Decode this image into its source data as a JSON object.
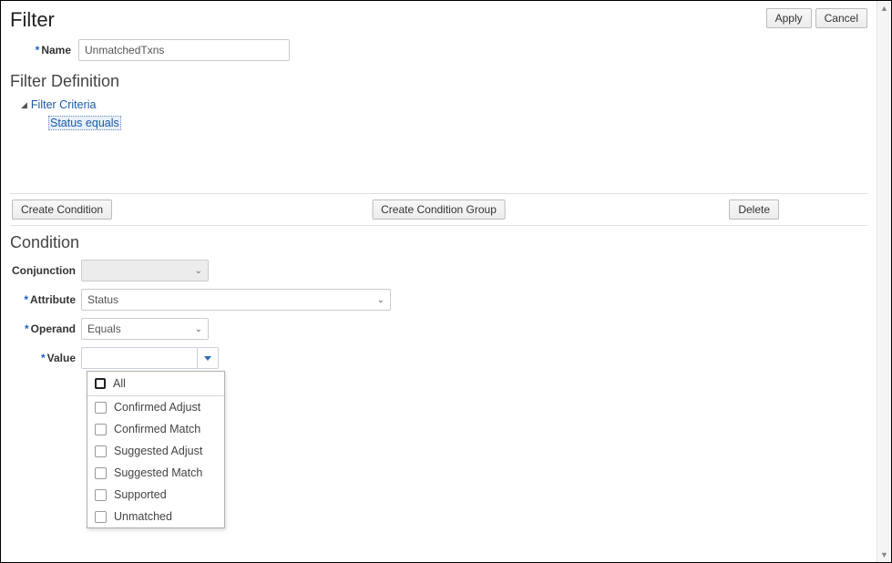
{
  "header": {
    "title": "Filter",
    "apply_label": "Apply",
    "cancel_label": "Cancel"
  },
  "name_field": {
    "label": "Name",
    "value": "UnmatchedTxns"
  },
  "definition": {
    "title": "Filter Definition",
    "root_label": "Filter Criteria",
    "child_label": "Status equals"
  },
  "actions": {
    "create_condition": "Create Condition",
    "create_group": "Create Condition Group",
    "delete": "Delete"
  },
  "condition": {
    "title": "Condition",
    "conjunction_label": "Conjunction",
    "conjunction_value": "",
    "attribute_label": "Attribute",
    "attribute_value": "Status",
    "operand_label": "Operand",
    "operand_value": "Equals",
    "value_label": "Value",
    "value_value": ""
  },
  "value_options": {
    "all": "All",
    "items": [
      "Confirmed Adjust",
      "Confirmed Match",
      "Suggested Adjust",
      "Suggested Match",
      "Supported",
      "Unmatched"
    ]
  }
}
